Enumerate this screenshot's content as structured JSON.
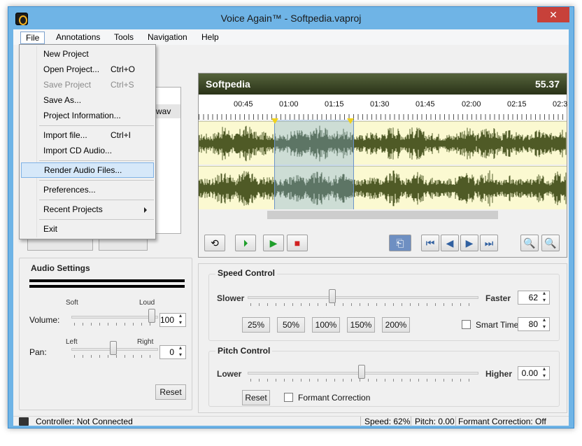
{
  "window": {
    "title": "Voice Again™ - Softpedia.vaproj",
    "close_glyph": "✕"
  },
  "menubar": [
    "File",
    "Annotations",
    "Tools",
    "Navigation",
    "Help"
  ],
  "file_menu": {
    "items": [
      {
        "label": "New Project",
        "shortcut": ""
      },
      {
        "label": "Open Project...",
        "shortcut": "Ctrl+O"
      },
      {
        "label": "Save Project",
        "shortcut": "Ctrl+S",
        "disabled": true
      },
      {
        "label": "Save As...",
        "shortcut": ""
      },
      {
        "label": "Project Information...",
        "shortcut": ""
      },
      {
        "label": "Import file...",
        "shortcut": "Ctrl+I"
      },
      {
        "label": "Import CD Audio...",
        "shortcut": ""
      },
      {
        "label": "Render Audio Files...",
        "shortcut": "",
        "highlighted": true
      },
      {
        "label": "Preferences...",
        "shortcut": ""
      },
      {
        "label": "Recent Projects",
        "shortcut": "",
        "submenu": true
      },
      {
        "label": "Exit",
        "shortcut": ""
      }
    ]
  },
  "file_list": {
    "partial_text": "wav"
  },
  "audio_settings": {
    "title": "Audio Settings",
    "volume_label": "Volume:",
    "volume_soft": "Soft",
    "volume_loud": "Loud",
    "volume_value": "100",
    "pan_label": "Pan:",
    "pan_left": "Left",
    "pan_right": "Right",
    "pan_value": "0",
    "reset": "Reset"
  },
  "waveform": {
    "track_name": "Softpedia",
    "position": "55.37",
    "ruler": [
      "00:45",
      "01:00",
      "01:15",
      "01:30",
      "01:45",
      "02:00",
      "02:15",
      "02:3"
    ],
    "colors": {
      "wave": "#4f5a26",
      "background": "#fbf9d1",
      "selection": "#78aadc"
    }
  },
  "transport": {
    "loop": "loop-icon",
    "play_selection": "play-selection-icon",
    "play": "play-icon",
    "stop": "stop-icon",
    "return": "return-icon",
    "first": "skip-start-icon",
    "prev": "step-back-icon",
    "next": "step-forward-icon",
    "last": "skip-end-icon",
    "zoom_out": "zoom-out-icon",
    "zoom_in": "zoom-in-icon"
  },
  "speed_control": {
    "title": "Speed Control",
    "slower": "Slower",
    "faster": "Faster",
    "value": "62",
    "presets": [
      "25%",
      "50%",
      "100%",
      "150%",
      "200%"
    ],
    "smart_time_label": "Smart Time:",
    "smart_time_value": "80",
    "level": 0.62
  },
  "pitch_control": {
    "title": "Pitch Control",
    "lower": "Lower",
    "higher": "Higher",
    "value": "0.00",
    "reset": "Reset",
    "formant_label": "Formant Correction"
  },
  "status": {
    "controller": "Controller: Not Connected",
    "speed": "Speed: 62%",
    "pitch": "Pitch: 0.00",
    "formant": "Formant Correction: Off"
  }
}
